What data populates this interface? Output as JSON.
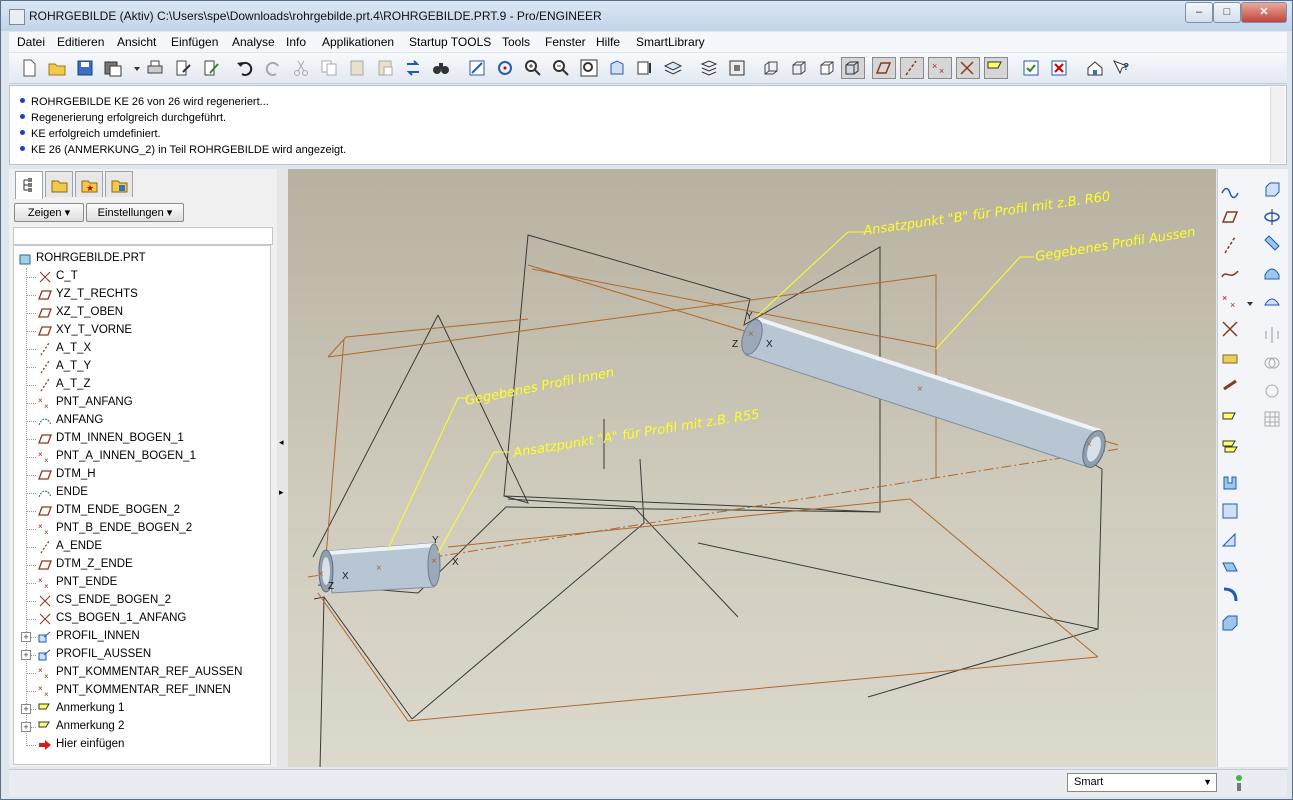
{
  "window": {
    "title": "ROHRGEBILDE (Aktiv) C:\\Users\\spe\\Downloads\\rohrgebilde.prt.4\\ROHRGEBILDE.PRT.9 - Pro/ENGINEER",
    "controls": {
      "minimize": "–",
      "maximize": "□",
      "close": "✕"
    }
  },
  "menu": [
    "Datei",
    "Editieren",
    "Ansicht",
    "Einfügen",
    "Analyse",
    "Info",
    "Applikationen",
    "Startup TOOLS",
    "Tools",
    "Fenster",
    "Hilfe",
    "SmartLibrary"
  ],
  "messages": [
    "ROHRGEBILDE KE 26 von 26 wird regeneriert...",
    "Regenerierung erfolgreich durchgeführt.",
    "KE erfolgreich umdefiniert.",
    "KE 26 (ANMERKUNG_2) in Teil ROHRGEBILDE wird angezeigt."
  ],
  "nav": {
    "show_button": "Zeigen",
    "settings_button": "Einstellungen",
    "tree_root": "ROHRGEBILDE.PRT",
    "tree": [
      {
        "label": "C_T",
        "icon": "csys"
      },
      {
        "label": "YZ_T_RECHTS",
        "icon": "plane"
      },
      {
        "label": "XZ_T_OBEN",
        "icon": "plane"
      },
      {
        "label": "XY_T_VORNE",
        "icon": "plane"
      },
      {
        "label": "A_T_X",
        "icon": "axis"
      },
      {
        "label": "A_T_Y",
        "icon": "axis"
      },
      {
        "label": "A_T_Z",
        "icon": "axis"
      },
      {
        "label": "PNT_ANFANG",
        "icon": "point"
      },
      {
        "label": "ANFANG",
        "icon": "graph"
      },
      {
        "label": "DTM_INNEN_BOGEN_1",
        "icon": "plane"
      },
      {
        "label": "PNT_A_INNEN_BOGEN_1",
        "icon": "point"
      },
      {
        "label": "DTM_H",
        "icon": "plane"
      },
      {
        "label": "ENDE",
        "icon": "graph"
      },
      {
        "label": "DTM_ENDE_BOGEN_2",
        "icon": "plane"
      },
      {
        "label": "PNT_B_ENDE_BOGEN_2",
        "icon": "point"
      },
      {
        "label": "A_ENDE",
        "icon": "axis"
      },
      {
        "label": "DTM_Z_ENDE",
        "icon": "plane"
      },
      {
        "label": "PNT_ENDE",
        "icon": "point"
      },
      {
        "label": "CS_ENDE_BOGEN_2",
        "icon": "csys"
      },
      {
        "label": "CS_BOGEN_1_ANFANG",
        "icon": "csys"
      },
      {
        "label": "PROFIL_INNEN",
        "icon": "copy",
        "expandable": true
      },
      {
        "label": "PROFIL_AUSSEN",
        "icon": "copy",
        "expandable": true
      },
      {
        "label": "PNT_KOMMENTAR_REF_AUSSEN",
        "icon": "point"
      },
      {
        "label": "PNT_KOMMENTAR_REF_INNEN",
        "icon": "point"
      },
      {
        "label": "Anmerkung 1",
        "icon": "note",
        "expandable": true
      },
      {
        "label": "Anmerkung 2",
        "icon": "note",
        "expandable": true
      },
      {
        "label": "Hier einfügen",
        "icon": "insert-arrow"
      }
    ]
  },
  "graphics": {
    "annotations": {
      "b": "Ansatzpunkt \"B\" für Profil mit z.B. R60",
      "outer": "Gegebenes Profil Aussen",
      "inner": "Gegebenes Profil Innen",
      "a": "Ansatzpunkt \"A\" für Profil mit z.B. R55"
    },
    "csys_labels": {
      "x": "X",
      "y": "Y",
      "z": "Z"
    },
    "colors": {
      "annotation": "#ffff22",
      "datum_plane": "#b0682a",
      "edge": "#3a3a3a",
      "pipe": "#b8c6d4"
    }
  },
  "status": {
    "filter_value": "Smart"
  }
}
